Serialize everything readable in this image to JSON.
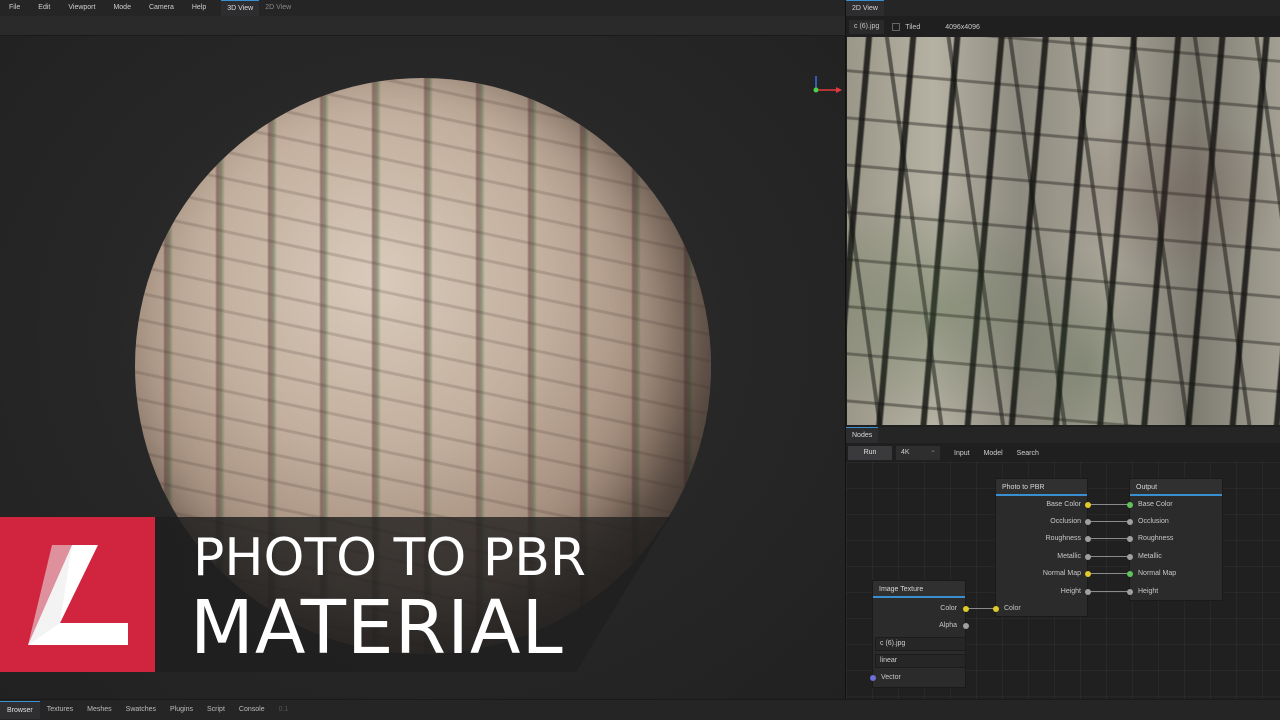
{
  "menu": {
    "items": [
      "File",
      "Edit",
      "Viewport",
      "Mode",
      "Camera",
      "Help"
    ],
    "tabs": [
      {
        "label": "3D View",
        "active": true
      },
      {
        "label": "2D View",
        "active": false
      }
    ]
  },
  "overlay": {
    "line1": "PHOTO TO PBR",
    "line2": "MATERIAL",
    "logo_color": "#d0243f"
  },
  "panel2d": {
    "tab": "2D View",
    "filename": "c (6).jpg",
    "tiled_label": "Tiled",
    "resolution": "4096x4096"
  },
  "nodes": {
    "tab": "Nodes",
    "run_label": "Run",
    "res_value": "4K",
    "tools": [
      "Input",
      "Model",
      "Search"
    ],
    "photo_to_pbr": {
      "title": "Photo to PBR",
      "outputs": [
        "Base Color",
        "Occlusion",
        "Roughness",
        "Metallic",
        "Normal Map",
        "Height"
      ],
      "input": "Color"
    },
    "output": {
      "title": "Output",
      "inputs": [
        "Base Color",
        "Occlusion",
        "Roughness",
        "Metallic",
        "Normal Map",
        "Height"
      ]
    },
    "image_texture": {
      "title": "Image Texture",
      "outputs": [
        "Color",
        "Alpha"
      ],
      "file": "c (6).jpg",
      "interp": "linear",
      "input": "Vector"
    }
  },
  "bottom": {
    "tabs": [
      "Browser",
      "Textures",
      "Meshes",
      "Swatches",
      "Plugins",
      "Script",
      "Console"
    ],
    "version": "0.1"
  },
  "colors": {
    "accent": "#3a8fd1",
    "port_yellow": "#e2c92a",
    "port_green": "#5fc458",
    "port_grey": "#a0a0a0",
    "port_blue": "#6b6fd6"
  }
}
